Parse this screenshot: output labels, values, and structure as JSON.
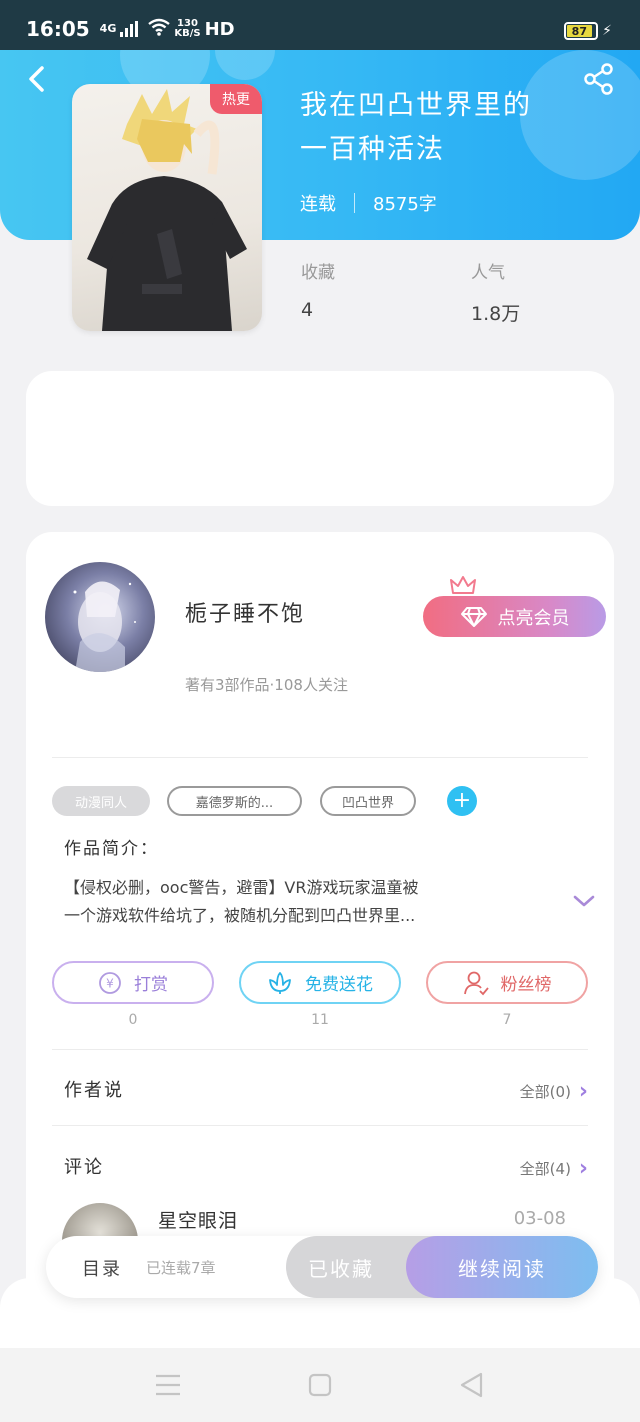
{
  "status_bar": {
    "time": "16:05",
    "network": "4G",
    "speed_value": "130",
    "speed_unit": "KB/S",
    "hd": "HD",
    "battery": "87",
    "battery_level": 0.87
  },
  "header": {
    "title_line1": "我在凹凸世界里的",
    "title_line2": "一百种活法",
    "status": "连载",
    "word_count": "8575字",
    "cover_badge": "热更"
  },
  "stats": {
    "favorites_label": "收藏",
    "favorites_value": "4",
    "popularity_label": "人气",
    "popularity_value": "1.8万"
  },
  "author": {
    "name": "栀子睡不饱",
    "info": "著有3部作品·108人关注",
    "vip_label": "点亮会员"
  },
  "tags": [
    "动漫同人",
    "嘉德罗斯的...",
    "凹凸世界"
  ],
  "intro": {
    "title": "作品简介：",
    "line1": "【侵权必删，ooc警告，避雷】VR游戏玩家温童被",
    "line2": "一个游戏软件给坑了，被随机分配到凹凸世界里..."
  },
  "actions": {
    "reward_label": "打赏",
    "reward_count": "0",
    "reward_icon": "¥",
    "flower_label": "免费送花",
    "flower_count": "11",
    "fans_label": "粉丝榜",
    "fans_count": "7"
  },
  "author_says": {
    "title": "作者说",
    "more": "全部(0)"
  },
  "comments": {
    "title": "评论",
    "more": "全部(4)",
    "first_user": "星空眼泪",
    "first_date": "03-08"
  },
  "bottom_bar": {
    "toc_label": "目录",
    "progress": "已连载7章",
    "fav_label": "已收藏",
    "read_label": "继续阅读"
  },
  "colors": {
    "header_blue": "#35b8f4",
    "accent_purple": "#b69ee6",
    "hot_red": "#ef5b6c",
    "flower_blue": "#2fc0f2",
    "fans_red": "#e87070",
    "reward_purple": "#b08ae0"
  }
}
